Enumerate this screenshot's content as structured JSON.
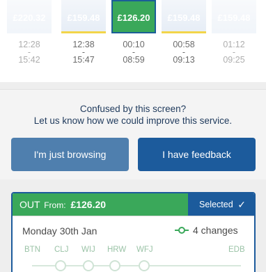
{
  "fares": [
    {
      "price": "£220.32",
      "depart": "12:28",
      "sep": "-",
      "arrive": "15:42",
      "selected": false
    },
    {
      "price": "£159.48",
      "depart": "12:38",
      "sep": "-",
      "arrive": "15:47",
      "selected": false
    },
    {
      "price": "£126.20",
      "depart": "00:10",
      "sep": "-",
      "arrive": "08:59",
      "selected": true
    },
    {
      "price": "£159.48",
      "depart": "00:58",
      "sep": "-",
      "arrive": "09:13",
      "selected": false
    },
    {
      "price": "£159.48",
      "depart": "01:12",
      "sep": "-",
      "arrive": "09:25",
      "selected": false
    }
  ],
  "feedback": {
    "line1": "Confused by this screen?",
    "line2": "Let us know how we could improve this service.",
    "browse_label": "I'm just browsing",
    "feedback_label": "I have feedback"
  },
  "journey": {
    "direction": "OUT",
    "from_label": "From:",
    "price": "£126.20",
    "selected_label": "Selected",
    "date": "Monday 30th Jan",
    "changes": "4 changes",
    "stations": [
      "BTN",
      "CLJ",
      "WIJ",
      "HRW",
      "WFJ",
      "EDB"
    ]
  },
  "colors": {
    "selected_green": "#3aa85a",
    "brand_blue": "#1c5b9c",
    "browse_blue": "#4f7fae",
    "cheapest_marker": "#f2d54a"
  },
  "icons": {
    "selected_tick": "check-icon",
    "changes": "changes-icon"
  }
}
